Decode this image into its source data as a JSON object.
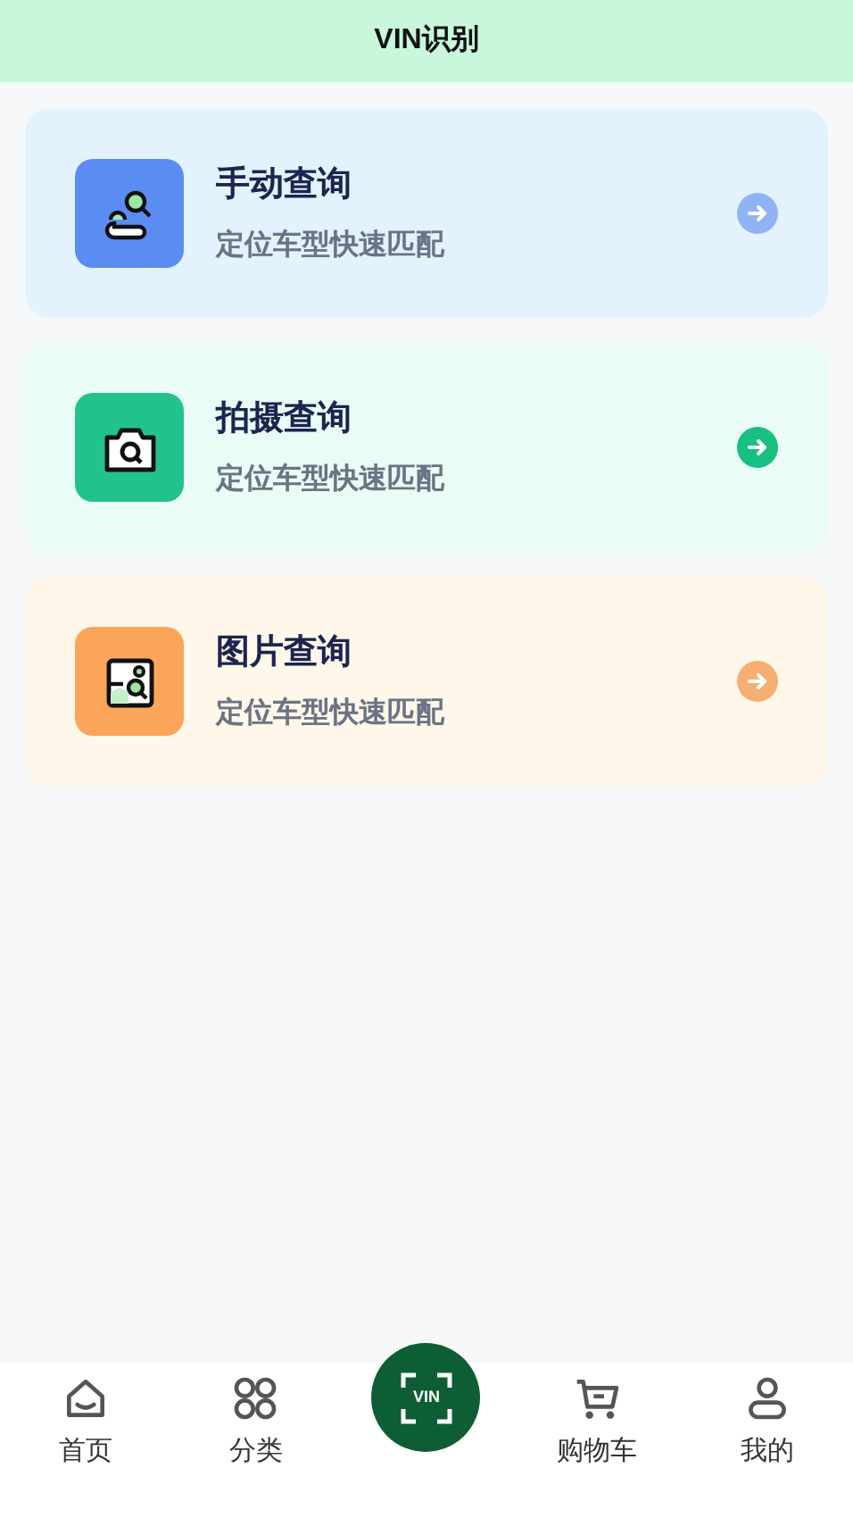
{
  "header": {
    "title": "VIN识别"
  },
  "cards": [
    {
      "kind": "manual",
      "title": "手动查询",
      "subtitle": "定位车型快速匹配"
    },
    {
      "kind": "camera",
      "title": "拍摄查询",
      "subtitle": "定位车型快速匹配"
    },
    {
      "kind": "image",
      "title": "图片查询",
      "subtitle": "定位车型快速匹配"
    }
  ],
  "tab_bar": {
    "items": [
      {
        "kind": "home",
        "label": "首页"
      },
      {
        "kind": "category",
        "label": "分类"
      },
      {
        "kind": "scan",
        "label": "VIN"
      },
      {
        "kind": "cart",
        "label": "购物车"
      },
      {
        "kind": "profile",
        "label": "我的"
      }
    ]
  }
}
